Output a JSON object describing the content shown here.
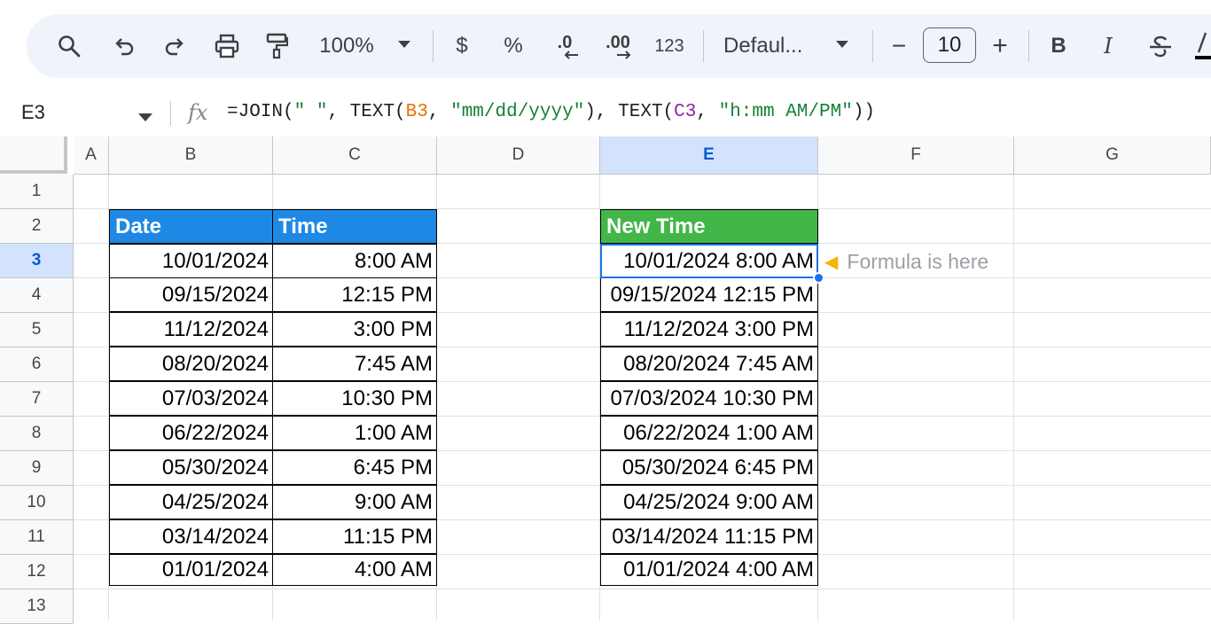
{
  "toolbar": {
    "zoom": "100%",
    "currency": "$",
    "percent": "%",
    "decrease_decimal": ".0",
    "increase_decimal": ".00",
    "number_format": "123",
    "font": "Defaul...",
    "font_size": "10",
    "minus": "−",
    "plus": "+",
    "bold": "B",
    "italic": "I",
    "icons": [
      "search-icon",
      "undo-icon",
      "redo-icon",
      "print-icon",
      "paint-format-icon",
      "dropdown-icon",
      "strikethrough-icon",
      "text-color-icon"
    ]
  },
  "formula_bar": {
    "cell_ref": "E3",
    "fx": "fx",
    "formula_parts": {
      "p1": "=JOIN(",
      "p2": "\" \"",
      "p3": ", TEXT(",
      "p4": "B3",
      "p5": ", ",
      "p6": "\"mm/dd/yyyy\"",
      "p7": "), TEXT(",
      "p8": "C3",
      "p9": ", ",
      "p10": "\"h:mm AM/PM\"",
      "p11": "))"
    }
  },
  "columns": [
    "A",
    "B",
    "C",
    "D",
    "E",
    "F",
    "G"
  ],
  "rows": [
    "1",
    "2",
    "3",
    "4",
    "5",
    "6",
    "7",
    "8",
    "9",
    "10",
    "11",
    "12",
    "13"
  ],
  "selected": {
    "column": "E",
    "row": "3"
  },
  "headers": {
    "date": "Date",
    "time": "Time",
    "new_time": "New Time"
  },
  "table": [
    {
      "date": "10/01/2024",
      "time": "8:00 AM",
      "new_time": "10/01/2024 8:00 AM"
    },
    {
      "date": "09/15/2024",
      "time": "12:15 PM",
      "new_time": "09/15/2024 12:15 PM"
    },
    {
      "date": "11/12/2024",
      "time": "3:00 PM",
      "new_time": "11/12/2024 3:00 PM"
    },
    {
      "date": "08/20/2024",
      "time": "7:45 AM",
      "new_time": "08/20/2024 7:45 AM"
    },
    {
      "date": "07/03/2024",
      "time": "10:30 PM",
      "new_time": "07/03/2024 10:30 PM"
    },
    {
      "date": "06/22/2024",
      "time": "1:00 AM",
      "new_time": "06/22/2024 1:00 AM"
    },
    {
      "date": "05/30/2024",
      "time": "6:45 PM",
      "new_time": "05/30/2024 6:45 PM"
    },
    {
      "date": "04/25/2024",
      "time": "9:00 AM",
      "new_time": "04/25/2024 9:00 AM"
    },
    {
      "date": "03/14/2024",
      "time": "11:15 PM",
      "new_time": "03/14/2024 11:15 PM"
    },
    {
      "date": "01/01/2024",
      "time": "4:00 AM",
      "new_time": "01/01/2024 4:00 AM"
    }
  ],
  "note": {
    "icon": "pointing-hand-icon",
    "text": "Formula is here"
  },
  "colors": {
    "header_blue": "#1e88e5",
    "header_green": "#43b649",
    "selection": "#1a73e8",
    "selected_header_bg": "#d3e3fd"
  }
}
